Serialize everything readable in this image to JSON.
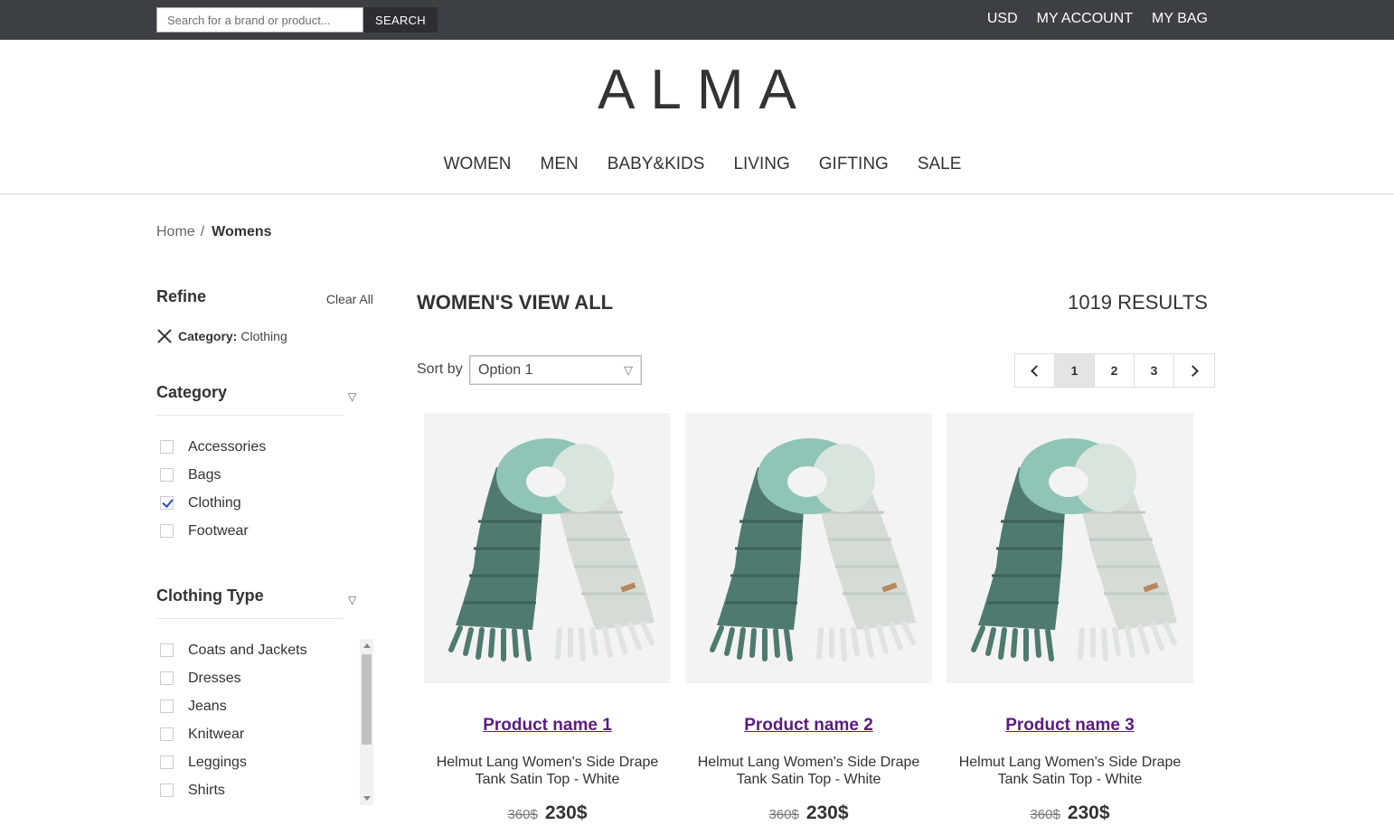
{
  "topbar": {
    "search_placeholder": "Search for a brand or product...",
    "search_button": "SEARCH",
    "currency": "USD",
    "account": "MY ACCOUNT",
    "bag": "MY BAG"
  },
  "logo": "ALMA",
  "nav": [
    "WOMEN",
    "MEN",
    "BABY&KIDS",
    "LIVING",
    "GIFTING",
    "SALE"
  ],
  "breadcrumb": {
    "home": "Home",
    "separator": "/",
    "current": "Womens"
  },
  "sidebar": {
    "refine": "Refine",
    "clear_all": "Clear All",
    "active_filter": {
      "label": "Category:",
      "value": "Clothing"
    },
    "category": {
      "title": "Category",
      "items": [
        {
          "label": "Accessories",
          "checked": false
        },
        {
          "label": "Bags",
          "checked": false
        },
        {
          "label": "Clothing",
          "checked": true
        },
        {
          "label": "Footwear",
          "checked": false
        }
      ]
    },
    "clothing_type": {
      "title": "Clothing Type",
      "items": [
        {
          "label": "Coats and Jackets",
          "checked": false
        },
        {
          "label": "Dresses",
          "checked": false
        },
        {
          "label": "Jeans",
          "checked": false
        },
        {
          "label": "Knitwear",
          "checked": false
        },
        {
          "label": "Leggings",
          "checked": false
        },
        {
          "label": "Shirts",
          "checked": false
        }
      ]
    }
  },
  "content": {
    "heading": "WOMEN'S VIEW ALL",
    "results": "1019 RESULTS",
    "sort_label": "Sort by",
    "sort_value": "Option 1",
    "pages": [
      "1",
      "2",
      "3"
    ],
    "current_page": "1"
  },
  "products": [
    {
      "name": "Product name 1",
      "desc_line1": "Helmut Lang Women's Side Drape",
      "desc_line2": "Tank Satin Top - White",
      "old_price": "360$",
      "new_price": "230$"
    },
    {
      "name": "Product name 2",
      "desc_line1": "Helmut Lang Women's Side Drape",
      "desc_line2": "Tank Satin Top - White",
      "old_price": "360$",
      "new_price": "230$"
    },
    {
      "name": "Product name 3",
      "desc_line1": "Helmut Lang Women's Side Drape",
      "desc_line2": "Tank Satin Top - White",
      "old_price": "360$",
      "new_price": "230$"
    }
  ],
  "colors": {
    "topbar_bg": "#3c3f44",
    "product_link": "#5a1a86",
    "checkbox_accent": "#2a4bc4"
  },
  "icons": [
    "close-icon",
    "chevron-down-icon",
    "chevron-left-icon",
    "chevron-right-icon",
    "scarf-image"
  ]
}
